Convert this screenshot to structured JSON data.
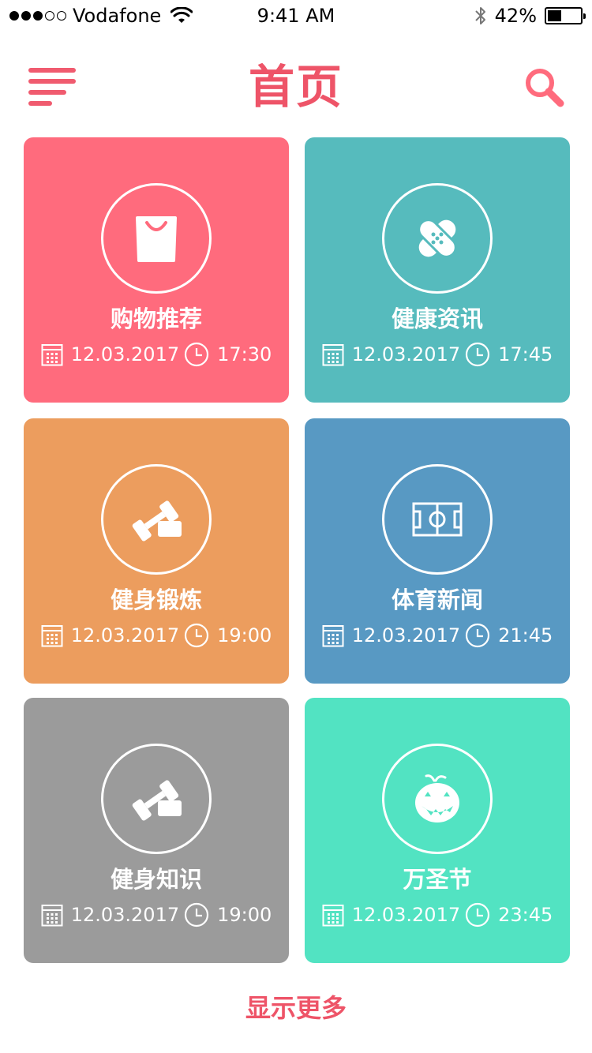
{
  "status_bar": {
    "carrier": "Vodafone",
    "time": "9:41 AM",
    "battery_text": "42%",
    "battery_level": 0.42
  },
  "header": {
    "title": "首页",
    "menu_icon": "menu-icon",
    "search_icon": "search-icon"
  },
  "colors": {
    "accent": "#ee5468",
    "pink": "#ff6b7d",
    "teal": "#56bbbd",
    "orange": "#ec9d5e",
    "blue": "#5899c3",
    "gray": "#9b9b9b",
    "mint": "#52e3c2"
  },
  "cards": [
    {
      "title": "购物推荐",
      "date": "12.03.2017",
      "time": "17:30",
      "icon": "shopping-bag-icon",
      "color": "#ff6b7d"
    },
    {
      "title": "健康资讯",
      "date": "12.03.2017",
      "time": "17:45",
      "icon": "bandage-icon",
      "color": "#56bbbd"
    },
    {
      "title": "健身锻炼",
      "date": "12.03.2017",
      "time": "19:00",
      "icon": "dumbbell-icon",
      "color": "#ec9d5e"
    },
    {
      "title": "体育新闻",
      "date": "12.03.2017",
      "time": "21:45",
      "icon": "soccer-field-icon",
      "color": "#5899c3"
    },
    {
      "title": "健身知识",
      "date": "12.03.2017",
      "time": "19:00",
      "icon": "dumbbell-icon",
      "color": "#9b9b9b"
    },
    {
      "title": "万圣节",
      "date": "12.03.2017",
      "time": "23:45",
      "icon": "pumpkin-icon",
      "color": "#52e3c2"
    }
  ],
  "show_more": "显示更多"
}
